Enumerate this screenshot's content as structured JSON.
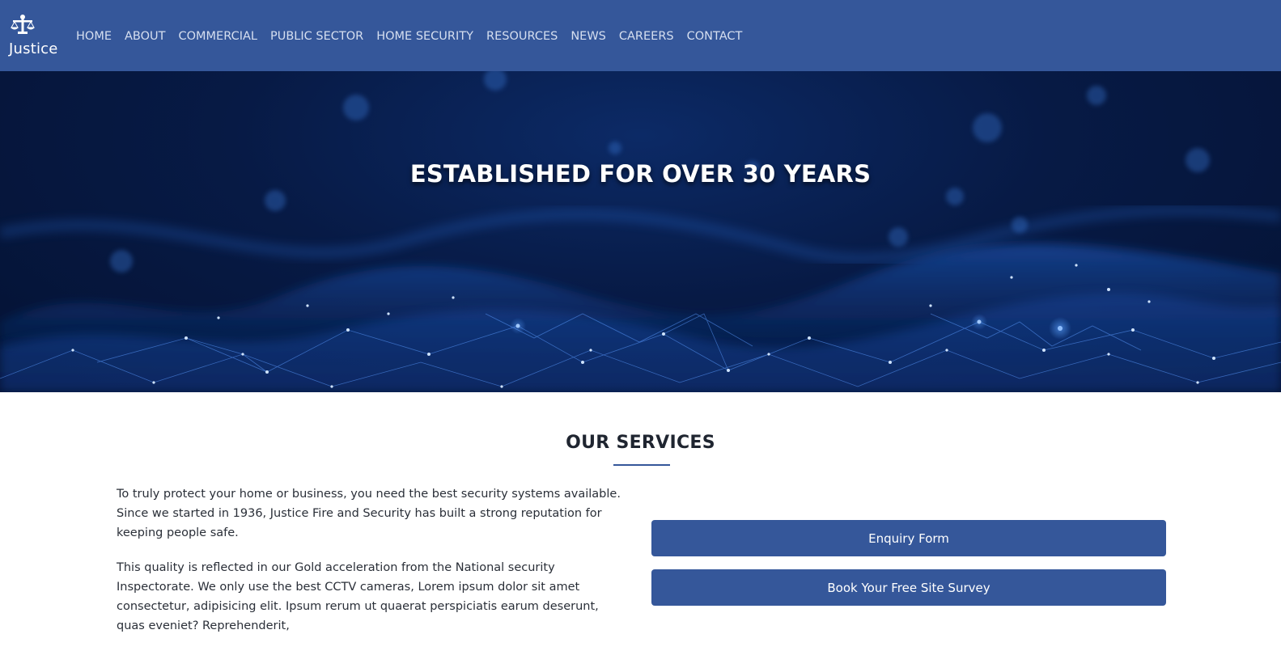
{
  "brand": {
    "name": "Justice",
    "icon": "scales-of-justice-icon"
  },
  "nav": {
    "items": [
      {
        "label": "HOME"
      },
      {
        "label": "ABOUT"
      },
      {
        "label": "COMMERCIAL"
      },
      {
        "label": "PUBLIC SECTOR"
      },
      {
        "label": "HOME SECURITY"
      },
      {
        "label": "RESOURCES"
      },
      {
        "label": "NEWS"
      },
      {
        "label": "CAREERS"
      },
      {
        "label": "CONTACT"
      }
    ]
  },
  "hero": {
    "title": "ESTABLISHED FOR OVER 30 YEARS"
  },
  "services": {
    "title": "OUR SERVICES",
    "paragraphs": [
      "To truly protect your home or business, you need the best security systems available. Since we started in 1936, Justice Fire and Security has built a strong reputation for keeping people safe.",
      "This quality is reflected in our Gold acceleration from the National security Inspectorate. We only use the best CCTV cameras, Lorem ipsum dolor sit amet consectetur, adipisicing elit. Ipsum rerum ut quaerat perspiciatis earum deserunt, quas eveniet? Reprehenderit,"
    ],
    "buttons": {
      "enquiry": "Enquiry Form",
      "survey": "Book Your Free Site Survey"
    }
  },
  "colors": {
    "navbar": "#35579a",
    "button": "#35579a",
    "hero_dark": "#041233"
  }
}
